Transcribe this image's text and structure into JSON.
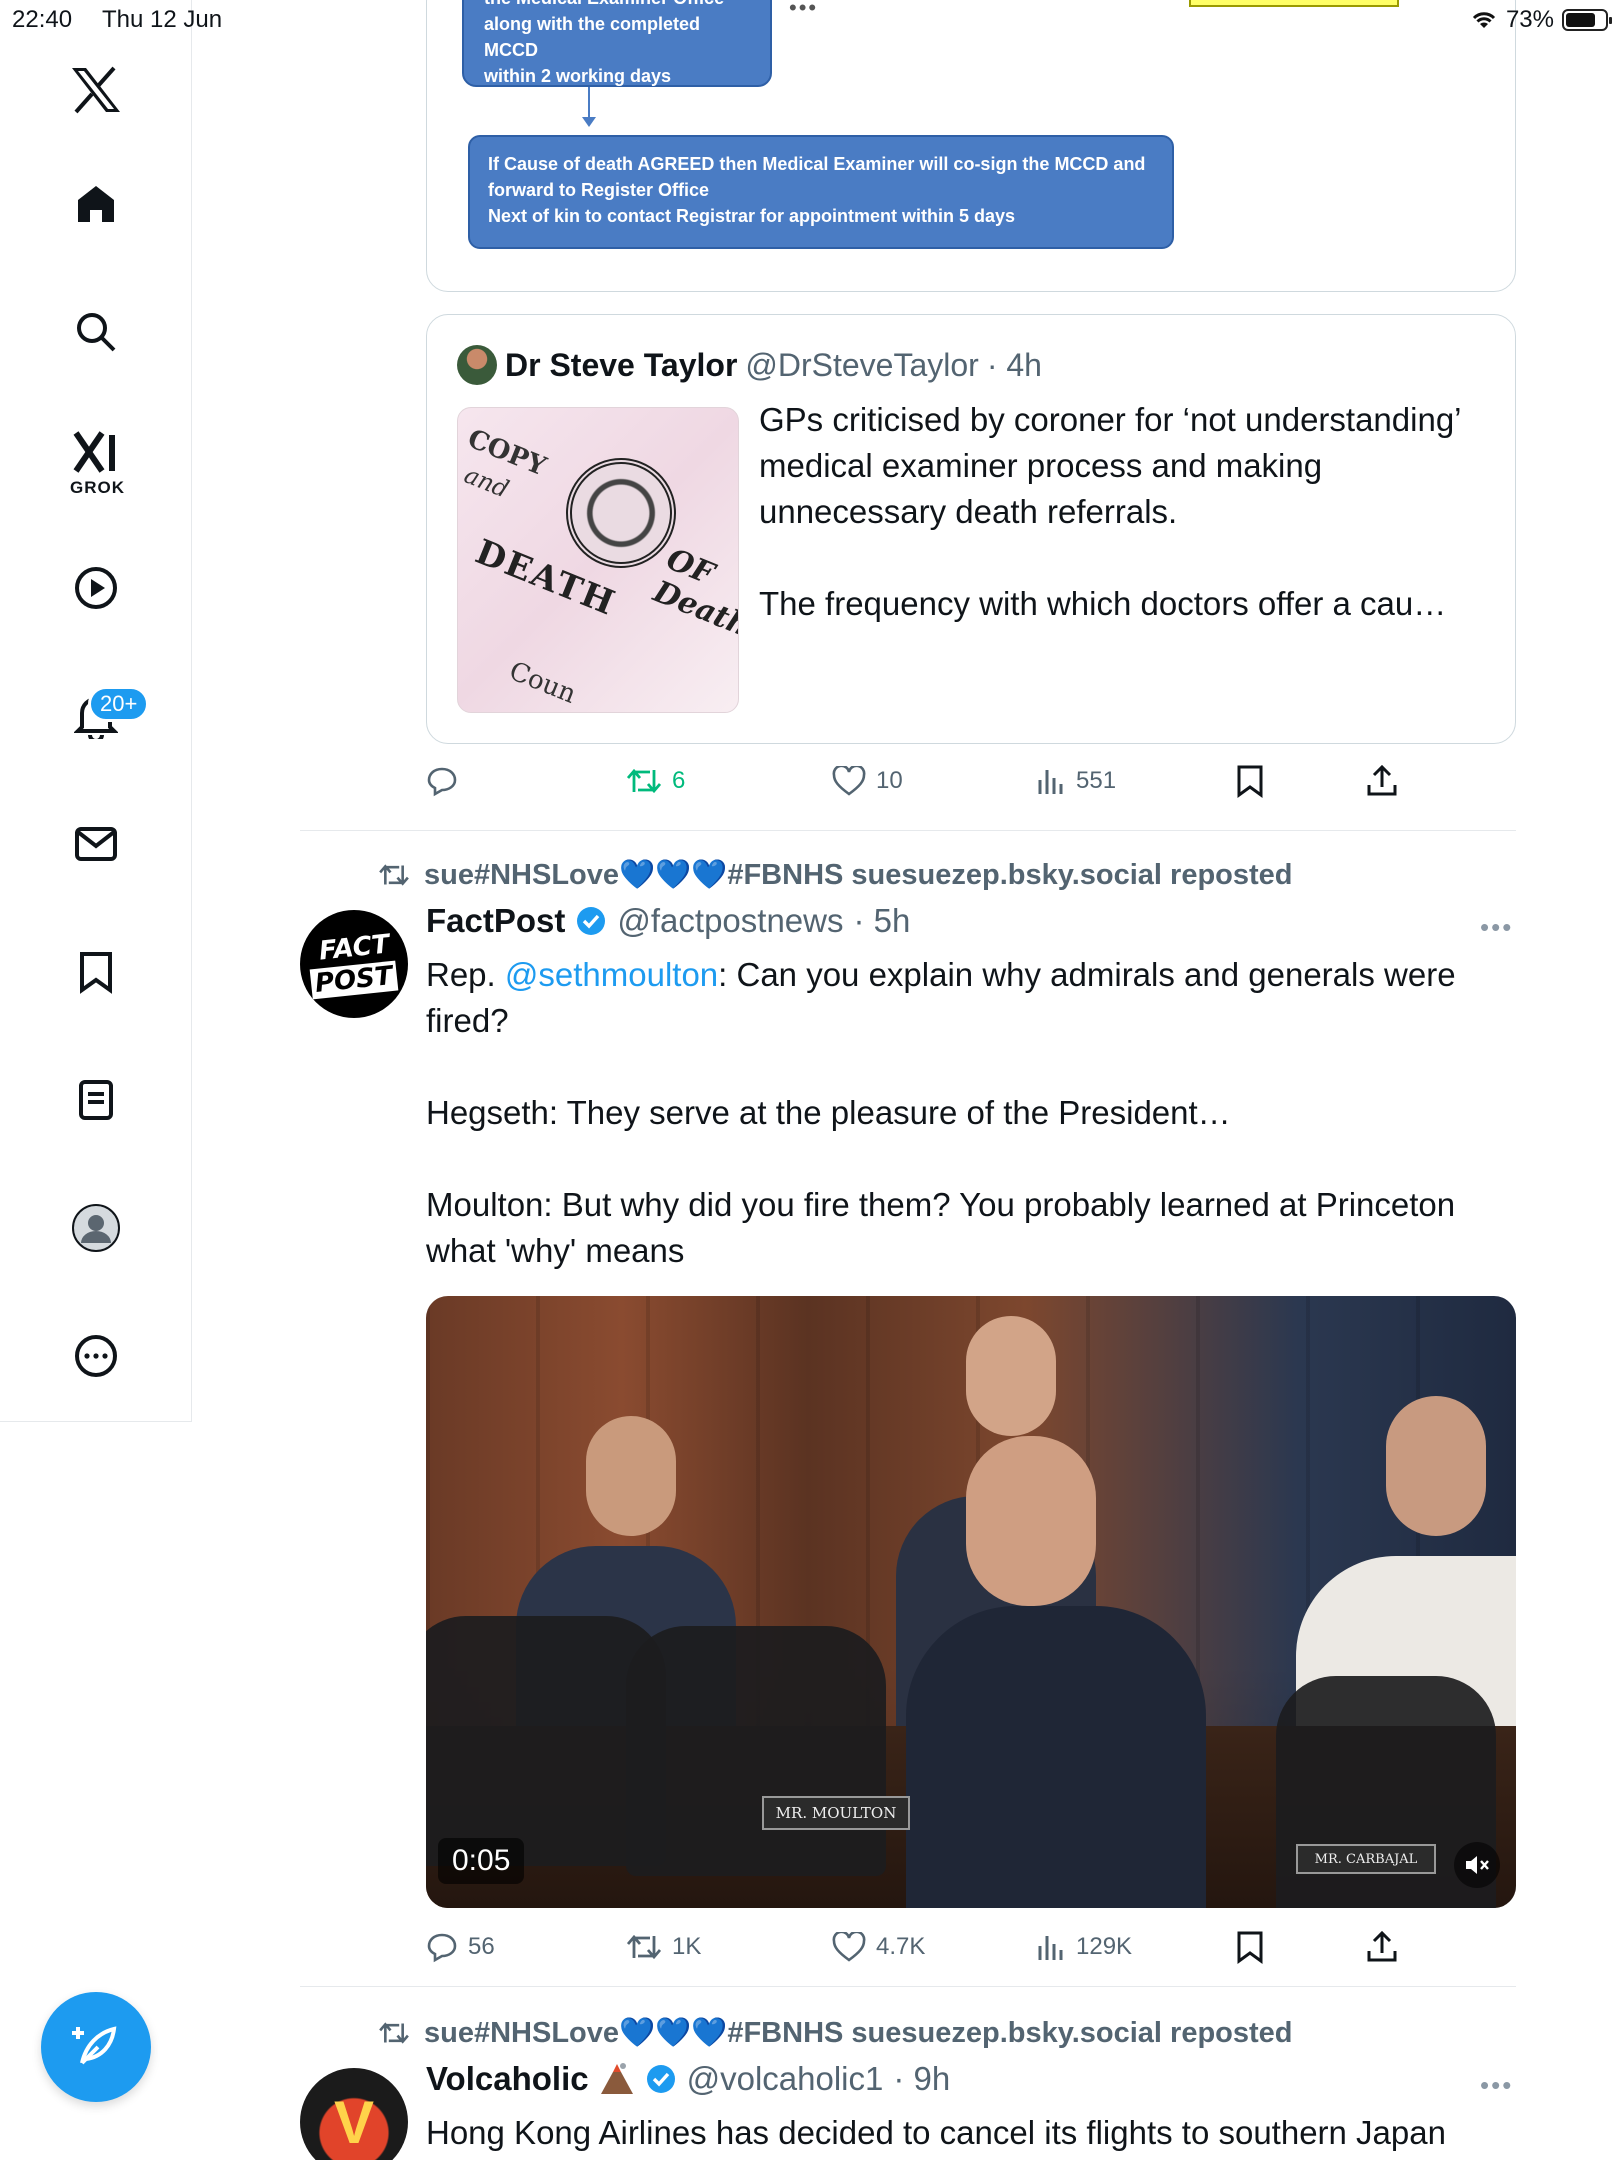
{
  "status_bar": {
    "time": "22:40",
    "date": "Thu 12 Jun",
    "battery": "73%"
  },
  "sidebar": {
    "grok_label": "GROK",
    "notifications_badge": "20+"
  },
  "flowchart": {
    "box1": "the Medical Examiner Office\nalong with the completed MCCD\nwithin 2 working days",
    "box2": "If Cause of death AGREED  then Medical Examiner will co-sign the MCCD and\nforward to Register Office\nNext of kin to contact Registrar for appointment within 5 days"
  },
  "quoted_tweet": {
    "name": "Dr Steve Taylor",
    "handle": "@DrSteveTaylor",
    "time": "· 4h",
    "text": "GPs criticised by coroner for ‘not understanding’ medical examiner process and making unnecessary death referrals.\n\nThe frequency with which doctors offer a cau…",
    "thumb": {
      "copy": "COPY",
      "and": "and",
      "death": "DEATH",
      "of": "OF",
      "death2": "Death",
      "coun": "Coun"
    }
  },
  "tweet1_actions": {
    "replies": "",
    "reposts": "6",
    "likes": "10",
    "views": "551"
  },
  "tweet2": {
    "repost_line": "sue#NHSLove💙💙💙#FBNHS suesuezep.bsky.social reposted",
    "name": "FactPost",
    "handle": "@factpostnews",
    "time": "· 5h",
    "avatar_top": "FACT",
    "avatar_bottom": "POST",
    "text_pre": "Rep. ",
    "mention": "@sethmoulton",
    "text_post": ":  Can you explain why admirals and generals were fired?\n\nHegseth: They serve at the pleasure of the President…\n\nMoulton: But why did you fire them? You probably learned at Princeton what 'why' means",
    "video_time": "0:05",
    "nameplate": "MR. MOULTON",
    "nameplate2": "MR. CARBAJAL",
    "actions": {
      "replies": "56",
      "reposts": "1K",
      "likes": "4.7K",
      "views": "129K"
    }
  },
  "tweet3": {
    "repost_line": "sue#NHSLove💙💙💙#FBNHS suesuezep.bsky.social reposted",
    "name": "Volcaholic",
    "handle": "@volcaholic1",
    "time": "· 9h",
    "avatar_letter": "V",
    "text": "Hong Kong Airlines has decided to cancel its flights to southern Japan"
  },
  "colors": {
    "accent": "#1d9bf0",
    "repost_green": "#00ba7c",
    "muted": "#536471"
  }
}
